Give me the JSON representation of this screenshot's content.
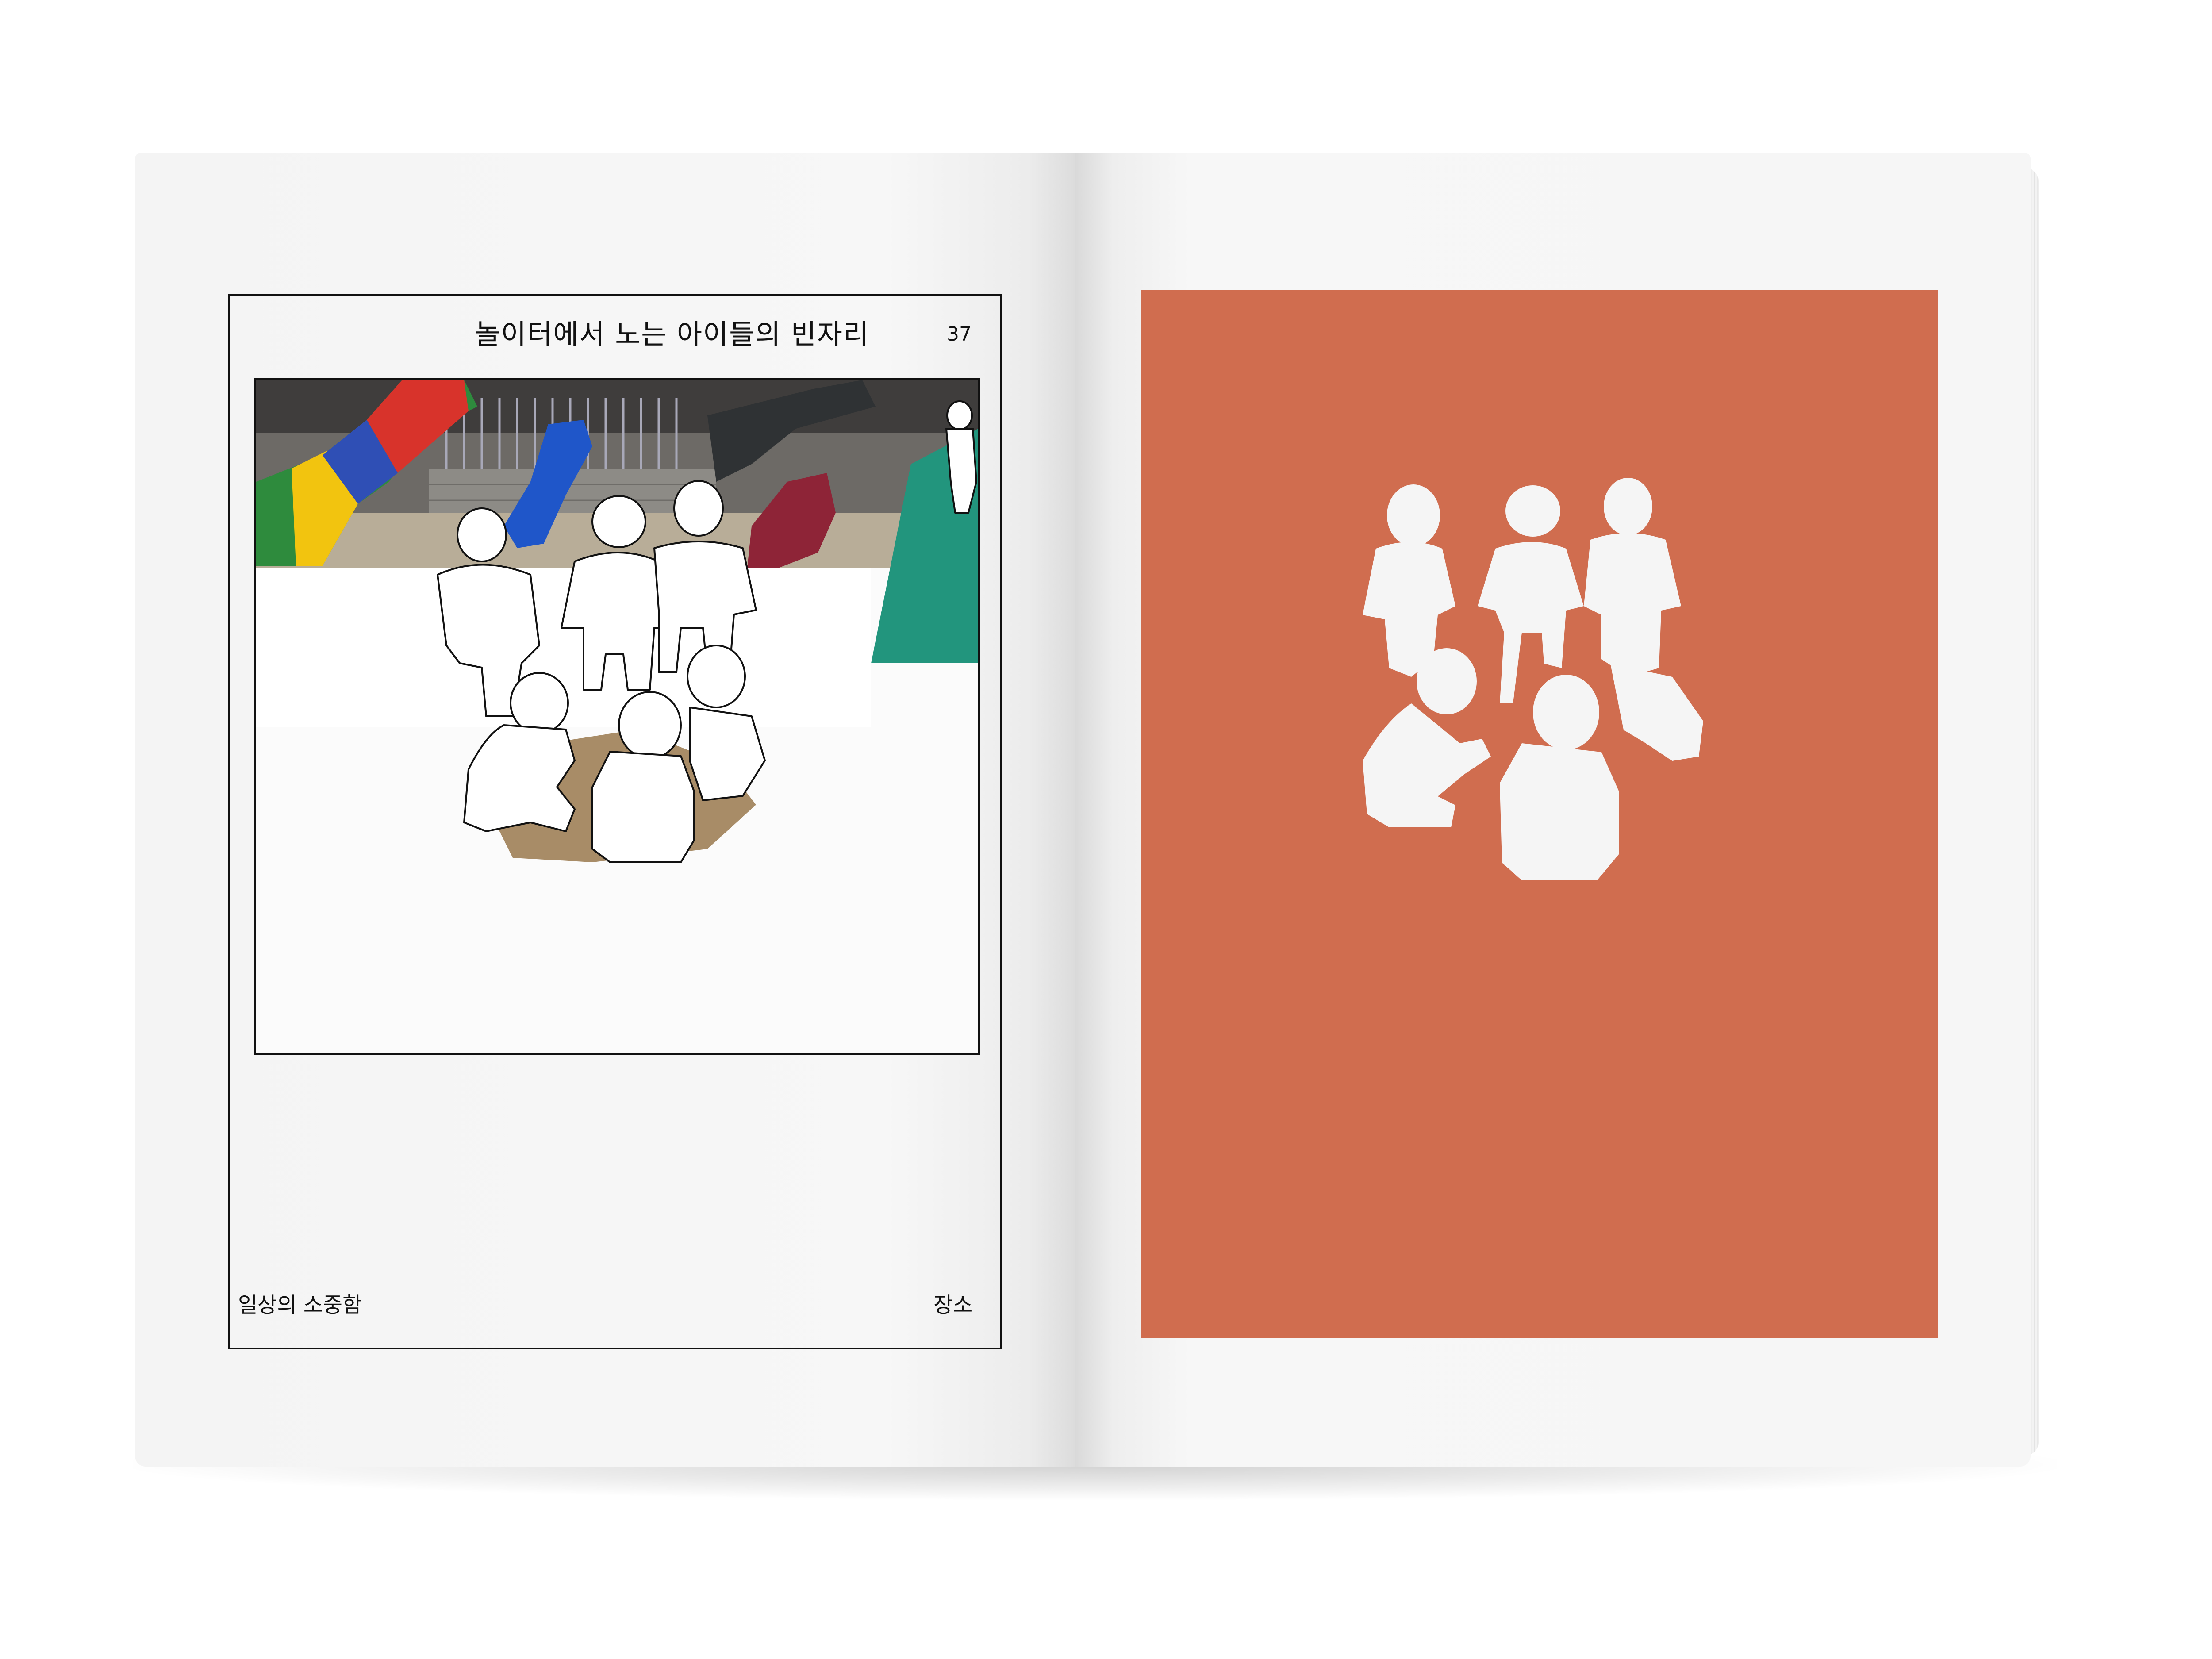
{
  "left_page": {
    "title": "놀이터에서 노는 아이들의 빈자리",
    "page_number": "37",
    "footer_left": "일상의 소중함",
    "footer_right": "장소"
  },
  "right_page": {
    "panel_color": "#d06d4f"
  },
  "colors": {
    "paper": "#f6f6f6",
    "frame_line": "#111111",
    "orange": "#d06d4f",
    "silhouette": "#f5f5f5"
  }
}
